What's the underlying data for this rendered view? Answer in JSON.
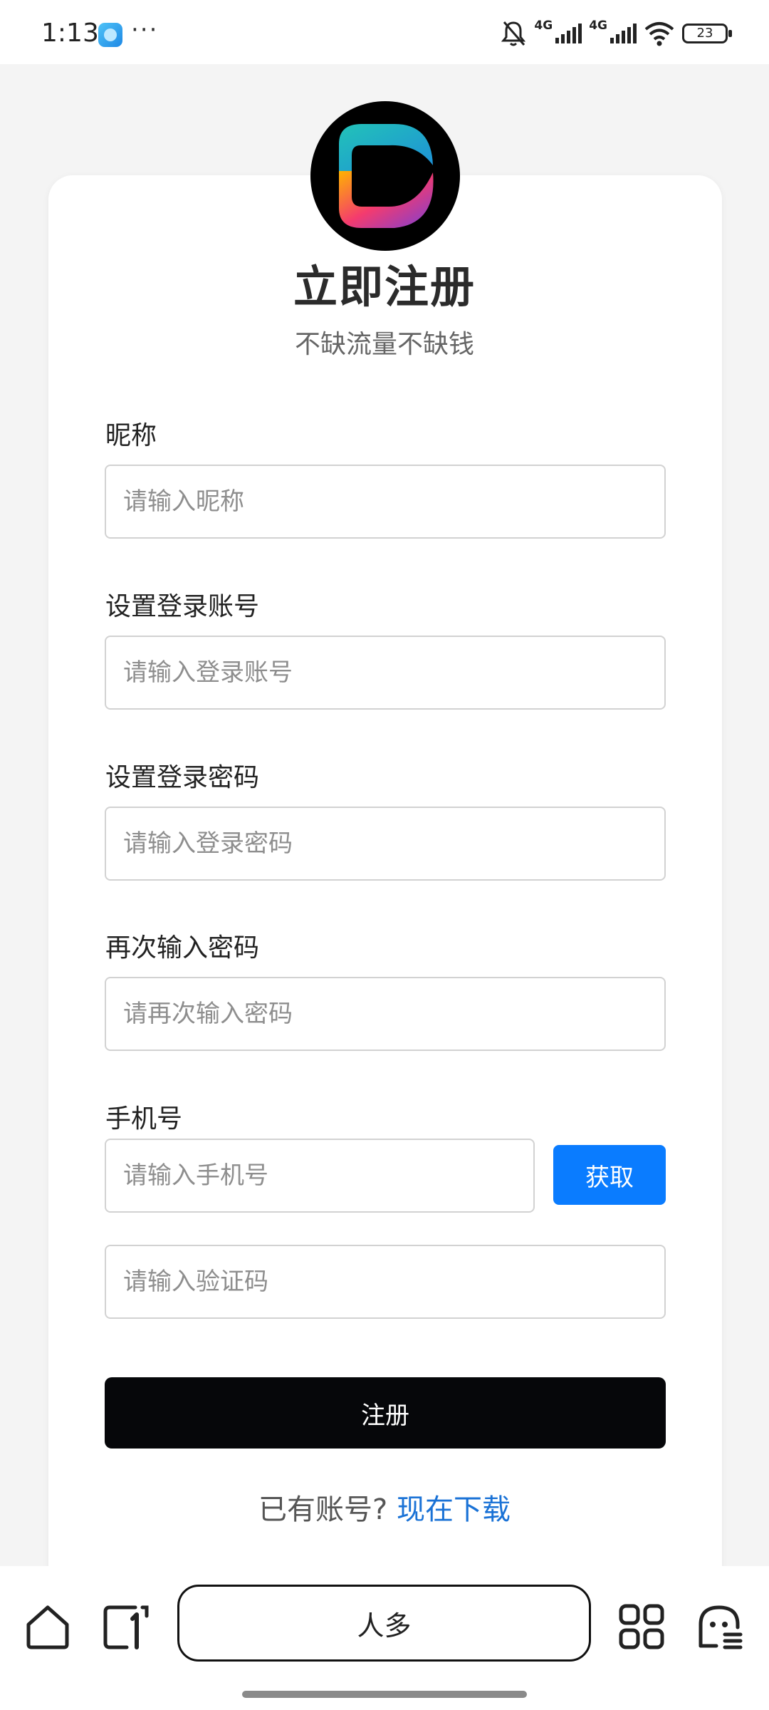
{
  "status_bar": {
    "time": "1:13",
    "network_1": "4G",
    "network_2": "4G",
    "battery": "23"
  },
  "header": {
    "title": "立即注册",
    "subtitle": "不缺流量不缺钱"
  },
  "form": {
    "nickname": {
      "label": "昵称",
      "placeholder": "请输入昵称"
    },
    "account": {
      "label": "设置登录账号",
      "placeholder": "请输入登录账号"
    },
    "password": {
      "label": "设置登录密码",
      "placeholder": "请输入登录密码"
    },
    "password_confirm": {
      "label": "再次输入密码",
      "placeholder": "请再次输入密码"
    },
    "phone": {
      "label": "手机号",
      "placeholder": "请输入手机号",
      "get_code_label": "获取"
    },
    "code": {
      "placeholder": "请输入验证码"
    },
    "submit_label": "注册"
  },
  "footer": {
    "question": "已有账号?",
    "link": "现在下载"
  },
  "bottom_nav": {
    "center_label": "人多"
  },
  "colors": {
    "accent": "#0a7cff",
    "link": "#1a72d6",
    "submit": "#06070a"
  }
}
